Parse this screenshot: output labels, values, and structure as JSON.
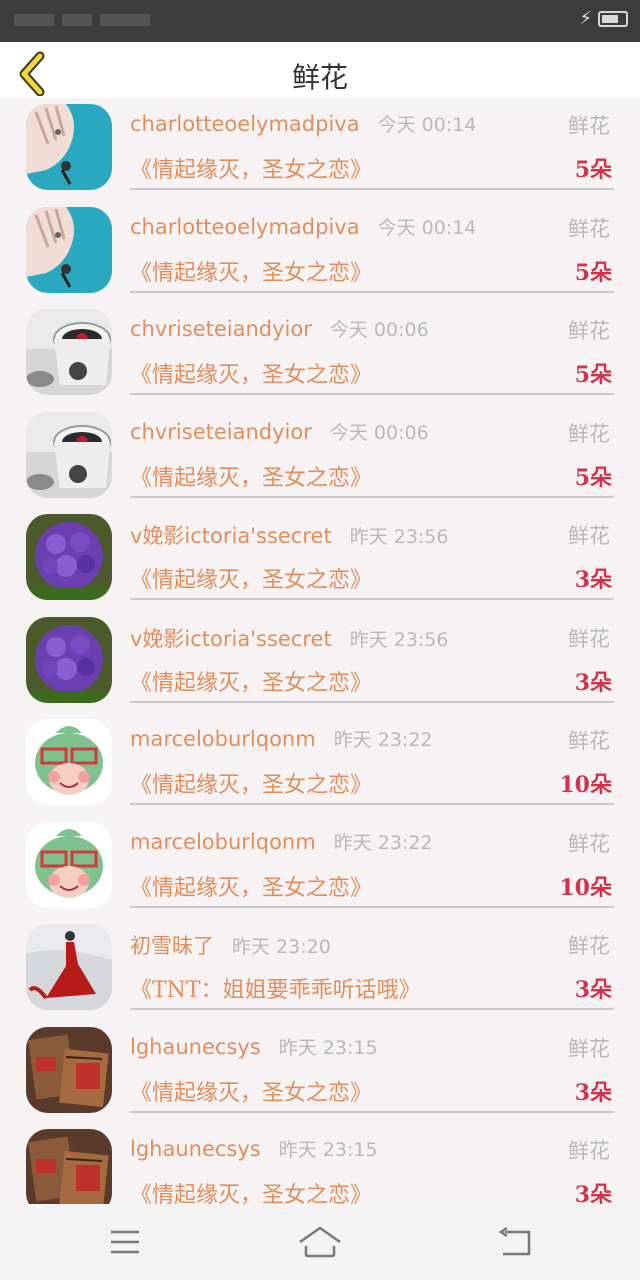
{
  "header": {
    "title": "鲜花"
  },
  "colors": {
    "accent": "#e38d5b",
    "count": "#d1334a",
    "muted": "#b8b8b8"
  },
  "rows": [
    {
      "username": "charlotteoelymadpiva",
      "time": "今天 00:14",
      "gift": "鲜花",
      "work": "《情起缘灭，圣女之恋》",
      "count": "5朵",
      "avatar": "hand-avatar"
    },
    {
      "username": "charlotteoelymadpiva",
      "time": "今天 00:14",
      "gift": "鲜花",
      "work": "《情起缘灭，圣女之恋》",
      "count": "5朵",
      "avatar": "hand-avatar"
    },
    {
      "username": "chvriseteiandyior",
      "time": "今天 00:06",
      "gift": "鲜花",
      "work": "《情起缘灭，圣女之恋》",
      "count": "5朵",
      "avatar": "coffee-cup-avatar"
    },
    {
      "username": "chvriseteiandyior",
      "time": "今天 00:06",
      "gift": "鲜花",
      "work": "《情起缘灭，圣女之恋》",
      "count": "5朵",
      "avatar": "coffee-cup-avatar"
    },
    {
      "username": "v娩影ictoria'ssecret",
      "time": "昨天 23:56",
      "gift": "鲜花",
      "work": "《情起缘灭，圣女之恋》",
      "count": "3朵",
      "avatar": "purple-flower-avatar"
    },
    {
      "username": "v娩影ictoria'ssecret",
      "time": "昨天 23:56",
      "gift": "鲜花",
      "work": "《情起缘灭，圣女之恋》",
      "count": "3朵",
      "avatar": "purple-flower-avatar"
    },
    {
      "username": "marceloburlqonm",
      "time": "昨天 23:22",
      "gift": "鲜花",
      "work": "《情起缘灭，圣女之恋》",
      "count": "10朵",
      "avatar": "cartoon-avatar"
    },
    {
      "username": "marceloburlqonm",
      "time": "昨天 23:22",
      "gift": "鲜花",
      "work": "《情起缘灭，圣女之恋》",
      "count": "10朵",
      "avatar": "cartoon-avatar"
    },
    {
      "username": "初雪昧了",
      "time": "昨天 23:20",
      "gift": "鲜花",
      "work": "《TNT：姐姐要乖乖听话哦》",
      "count": "3朵",
      "avatar": "red-dress-avatar"
    },
    {
      "username": "lghaunecsys",
      "time": "昨天 23:15",
      "gift": "鲜花",
      "work": "《情起缘灭，圣女之恋》",
      "count": "3朵",
      "avatar": "gift-box-avatar"
    },
    {
      "username": "lghaunecsys",
      "time": "昨天 23:15",
      "gift": "鲜花",
      "work": "《情起缘灭，圣女之恋》",
      "count": "3朵",
      "avatar": "gift-box-avatar"
    }
  ],
  "nav": {
    "menu_icon": "menu-icon",
    "home_icon": "home-icon",
    "back_icon": "back-arrow-icon"
  }
}
